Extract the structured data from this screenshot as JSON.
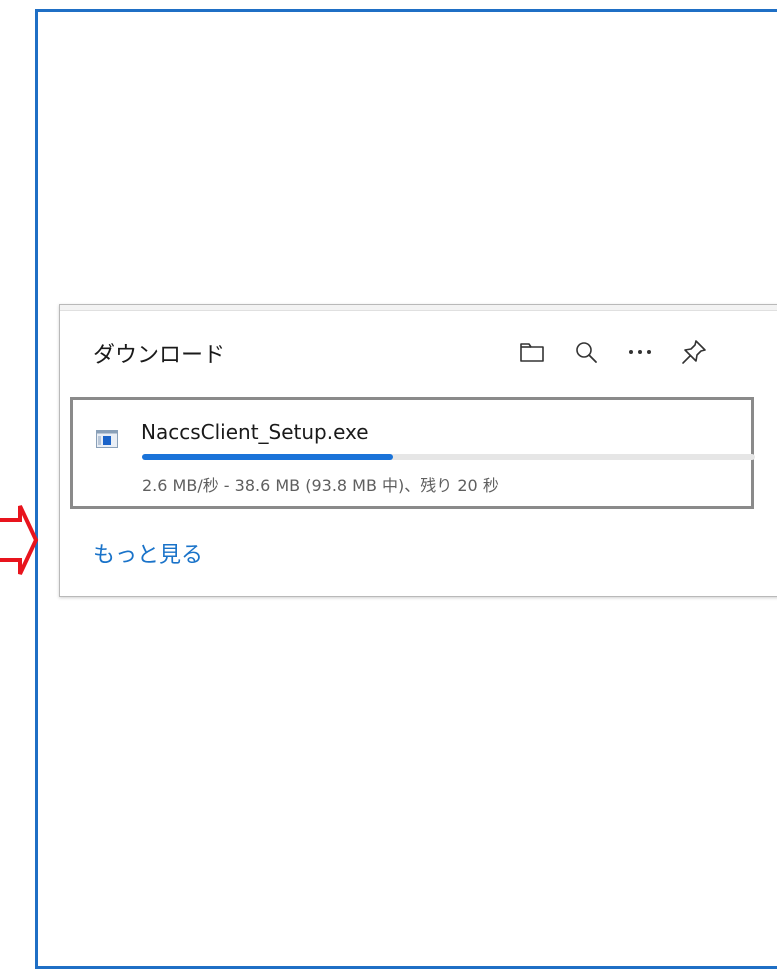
{
  "downloads_panel": {
    "title": "ダウンロード",
    "toolbar": {
      "icons": [
        "folder-icon",
        "search-icon",
        "more-icon",
        "pin-icon"
      ]
    },
    "item": {
      "file_name": "NaccsClient_Setup.exe",
      "progress_fraction": 0.41,
      "status": "2.6 MB/秒 - 38.6 MB (93.8 MB 中)、残り 20 秒"
    },
    "more_link": "もっと見る"
  },
  "colors": {
    "frame_border": "#1f6fc5",
    "arrow": "#e8141d",
    "progress": "#1a73d9",
    "link": "#1a73c9"
  }
}
